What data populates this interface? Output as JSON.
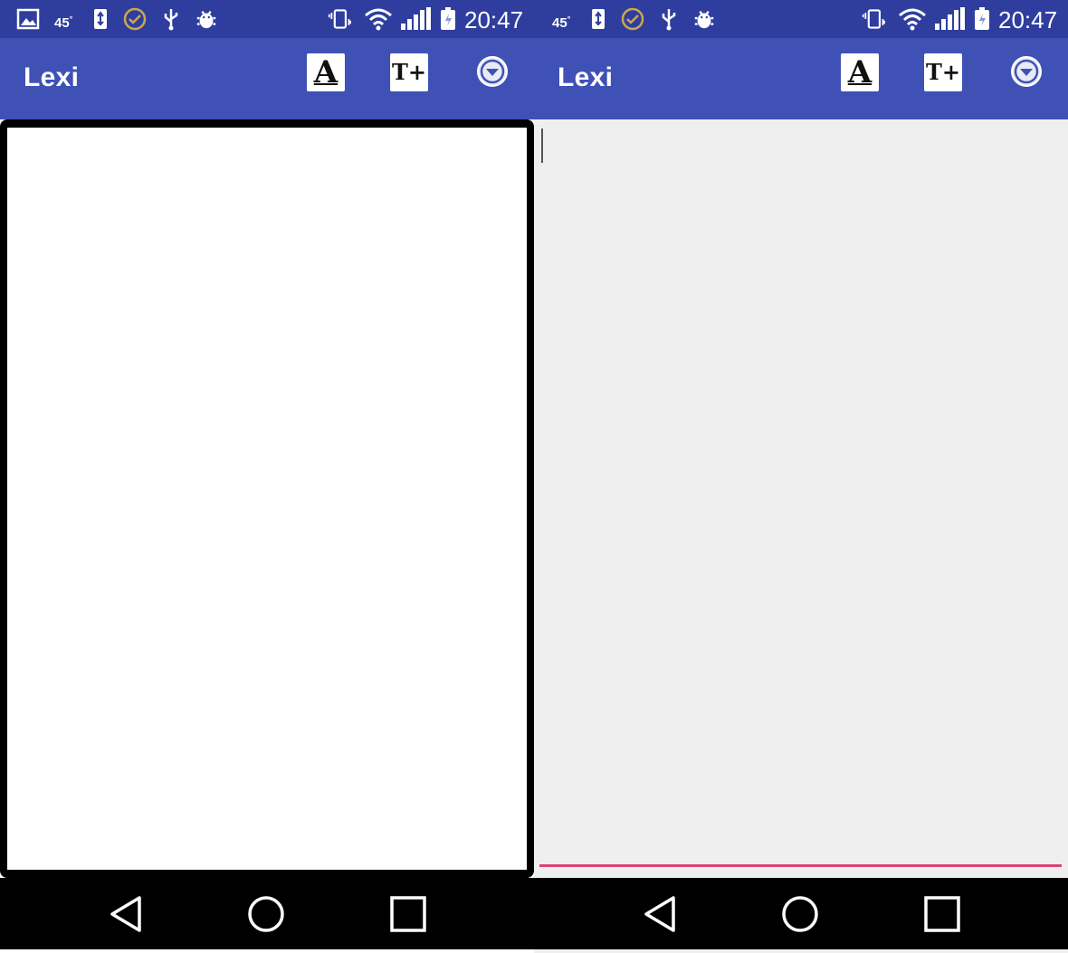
{
  "screens": [
    {
      "status": {
        "time": "20:47",
        "temperature": "45",
        "degree_sign": "°"
      },
      "app_title": "Lexi",
      "toolbar": {
        "font_glyph": "A",
        "size_glyph": "T+"
      }
    },
    {
      "status": {
        "time": "20:47",
        "temperature": "45",
        "degree_sign": "°"
      },
      "app_title": "Lexi",
      "toolbar": {
        "font_glyph": "A",
        "size_glyph": "T+"
      },
      "editor": {
        "text": ""
      }
    }
  ],
  "colors": {
    "status_bar": "#2f3e9e",
    "app_bar": "#3f51b5",
    "text_field_underline": "#d9417a",
    "editor_background": "#efefef",
    "nav_bar": "#000000"
  },
  "icons": {
    "status_bar_left": [
      "gallery-icon",
      "usb-storage-icon",
      "check-circle-icon",
      "usb-icon",
      "bug-icon"
    ],
    "status_bar_right": [
      "vibrate-icon",
      "wifi-icon",
      "signal-icon",
      "battery-charging-icon"
    ],
    "nav_bar": [
      "back-icon",
      "home-icon",
      "recents-icon"
    ],
    "toolbar_overflow": "dropdown-circle-icon"
  }
}
